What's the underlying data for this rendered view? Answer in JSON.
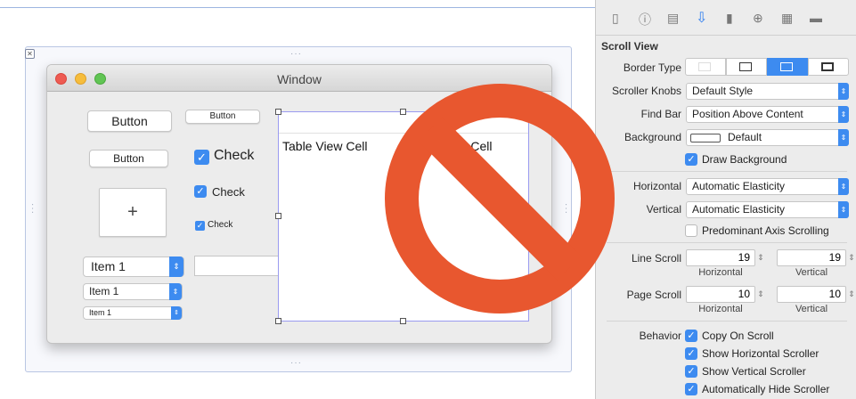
{
  "canvas": {
    "frame_dots": "···",
    "close_glyph": "✕"
  },
  "window": {
    "title": "Window",
    "button_large": "Button",
    "button_small": "Button",
    "button_medium": "Button",
    "plus": "+",
    "check_large": "Check",
    "check_medium": "Check",
    "check_small": "Check",
    "popup_large": "Item 1",
    "popup_medium": "Item 1",
    "popup_small": "Item 1",
    "table_cell_1": "Table View Cell",
    "table_cell_2": "Table View Cell"
  },
  "inspector": {
    "section_title": "Scroll View",
    "border_type_label": "Border Type",
    "scroller_knobs_label": "Scroller Knobs",
    "scroller_knobs_value": "Default Style",
    "find_bar_label": "Find Bar",
    "find_bar_value": "Position Above Content",
    "background_label": "Background",
    "background_value": "Default",
    "draw_background": "Draw Background",
    "horizontal_label": "Horizontal",
    "horizontal_value": "Automatic Elasticity",
    "vertical_label": "Vertical",
    "vertical_value": "Automatic Elasticity",
    "predominant": "Predominant Axis Scrolling",
    "line_scroll_label": "Line Scroll",
    "line_scroll_h": "19",
    "line_scroll_v": "19",
    "page_scroll_label": "Page Scroll",
    "page_scroll_h": "10",
    "page_scroll_v": "10",
    "sub_horizontal": "Horizontal",
    "sub_vertical": "Vertical",
    "behavior_label": "Behavior",
    "copy_on_scroll": "Copy On Scroll",
    "show_horizontal": "Show Horizontal Scroller",
    "show_vertical": "Show Vertical Scroller",
    "auto_hide": "Automatically Hide Scroller"
  },
  "colors": {
    "accent": "#3d8bf0",
    "prohibition": "#e8572f"
  },
  "icons": [
    "file-icon",
    "help-icon",
    "identity-icon",
    "attributes-icon",
    "size-icon",
    "connections-icon",
    "bindings-icon",
    "effects-icon"
  ]
}
